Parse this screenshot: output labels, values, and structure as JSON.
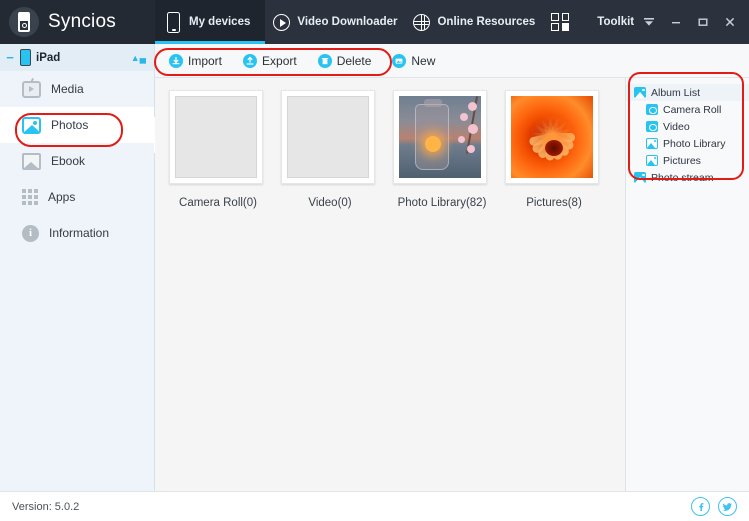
{
  "app": {
    "name": "Syncios",
    "logo_icon": "syncios-logo-icon"
  },
  "topnav": {
    "tabs": [
      {
        "label": "My devices",
        "icon": "phone-icon",
        "active": true
      },
      {
        "label": "Video Downloader",
        "icon": "play-circle-icon",
        "active": false
      },
      {
        "label": "Online Resources",
        "icon": "globe-icon",
        "active": false
      },
      {
        "label": "Toolkit",
        "icon": "grid-squares-icon",
        "active": false
      }
    ],
    "window_controls": [
      {
        "name": "menu-button",
        "icon": "caret-down-icon"
      },
      {
        "name": "minimize-button",
        "icon": "minimize-icon"
      },
      {
        "name": "maximize-button",
        "icon": "maximize-icon"
      },
      {
        "name": "close-button",
        "icon": "close-icon"
      }
    ]
  },
  "sidebar": {
    "device": {
      "label": "iPad",
      "collapse_icon": "minus-icon",
      "device_icon": "ipad-icon",
      "eject_icon": "eject-icon"
    },
    "items": [
      {
        "label": "Media",
        "icon": "media-icon",
        "selected": false
      },
      {
        "label": "Photos",
        "icon": "photos-icon",
        "selected": true
      },
      {
        "label": "Ebook",
        "icon": "ebook-icon",
        "selected": false
      },
      {
        "label": "Apps",
        "icon": "apps-grid-icon",
        "selected": false
      },
      {
        "label": "Information",
        "icon": "info-icon",
        "selected": false
      }
    ],
    "collapse_handle_icon": "chevron-left-icon"
  },
  "actionbar": {
    "buttons": [
      {
        "label": "Import",
        "icon": "import-icon"
      },
      {
        "label": "Export",
        "icon": "export-icon"
      },
      {
        "label": "Delete",
        "icon": "trash-icon"
      },
      {
        "label": "New",
        "icon": "new-folder-icon"
      }
    ]
  },
  "content": {
    "albums": [
      {
        "caption": "Camera Roll(0)",
        "thumb": "empty"
      },
      {
        "caption": "Video(0)",
        "thumb": "empty"
      },
      {
        "caption": "Photo Library(82)",
        "thumb": "sunset-jar-blossom"
      },
      {
        "caption": "Pictures(8)",
        "thumb": "orange-chrysanthemum"
      }
    ]
  },
  "album_panel": {
    "rows": [
      {
        "label": "Album List",
        "icon": "album-icon",
        "level": "head"
      },
      {
        "label": "Camera Roll",
        "icon": "camera-icon",
        "level": "sub"
      },
      {
        "label": "Video",
        "icon": "camera-icon",
        "level": "sub"
      },
      {
        "label": "Photo Library",
        "icon": "picture-icon",
        "level": "sub"
      },
      {
        "label": "Pictures",
        "icon": "picture-icon",
        "level": "sub"
      },
      {
        "label": "Photo stream",
        "icon": "album-icon",
        "level": "root"
      }
    ]
  },
  "footer": {
    "version": "Version: 5.0.2",
    "social": [
      {
        "name": "facebook-icon",
        "glyph": "f"
      },
      {
        "name": "twitter-icon",
        "glyph": "t"
      }
    ]
  },
  "annotations": {
    "color": "#e21b15",
    "regions": [
      "action-toolbar",
      "sidebar-photos-item",
      "album-list-panel"
    ]
  }
}
